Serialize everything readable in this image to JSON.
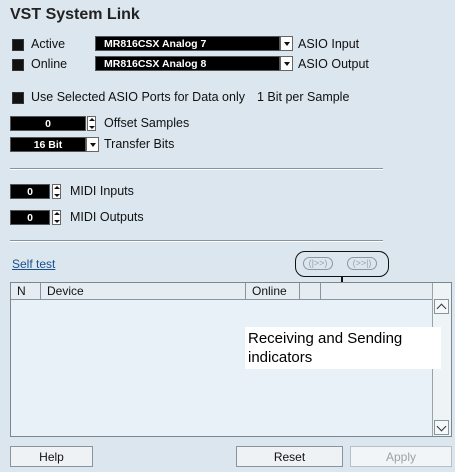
{
  "title": "VST System Link",
  "active": {
    "label": "Active",
    "port": "MR816CSX Analog 7",
    "port_type": "ASIO Input"
  },
  "online": {
    "label": "Online",
    "port": "MR816CSX Analog 8",
    "port_type": "ASIO Output"
  },
  "use_selected": {
    "label": "Use Selected ASIO Ports for Data only",
    "note": "1 Bit per Sample"
  },
  "offset": {
    "value": "0",
    "label": "Offset Samples"
  },
  "transfer": {
    "value": "16 Bit",
    "label": "Transfer Bits"
  },
  "midi_inputs": {
    "value": "0",
    "label": "MIDI Inputs"
  },
  "midi_outputs": {
    "value": "0",
    "label": "MIDI Outputs"
  },
  "self_test": "Self test",
  "indicators": {
    "receive": "(|>>)",
    "send": "(>>|)"
  },
  "table": {
    "columns": [
      "N",
      "Device",
      "Online",
      "",
      ""
    ]
  },
  "callout": "Receiving and Sending indicators",
  "buttons": {
    "help": "Help",
    "reset": "Reset",
    "apply": "Apply"
  },
  "icons": [
    "checkbox-icon",
    "dropdown-arrow-icon",
    "spinner-icon",
    "scroll-up-icon",
    "scroll-down-icon"
  ]
}
